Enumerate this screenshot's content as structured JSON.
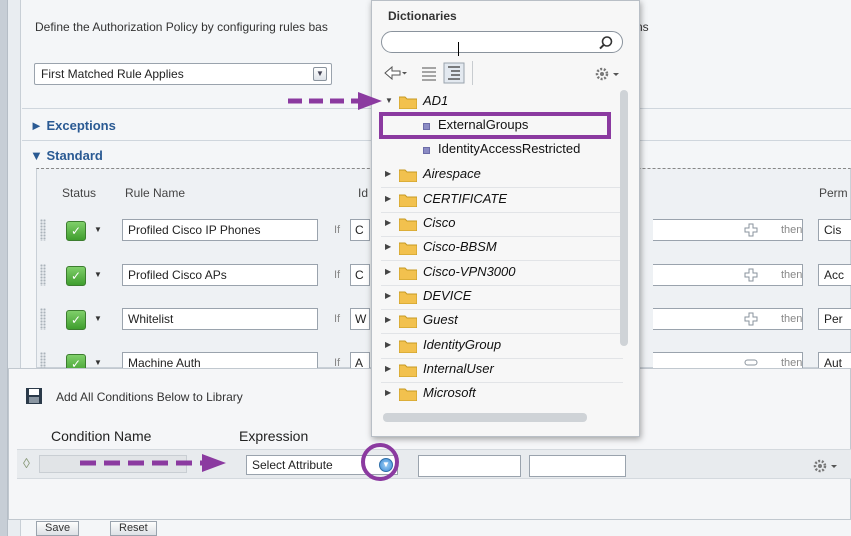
{
  "policy": {
    "description": "Define the Authorization Policy by configuring rules bas",
    "description_tail": "ns",
    "match_mode": "First Matched Rule Applies"
  },
  "sections": {
    "exceptions": "► Exceptions",
    "standard": "▼ Standard"
  },
  "table": {
    "col_status": "Status",
    "col_rule_name": "Rule Name",
    "col_identity": "Id",
    "col_permissions": "Perm"
  },
  "rules": [
    {
      "name": "Profiled Cisco IP Phones",
      "if": "If",
      "cond": "C",
      "then": "then",
      "perm": "Cis",
      "action_icon": "plus-icon"
    },
    {
      "name": "Profiled Cisco APs",
      "if": "If",
      "cond": "C",
      "then": "then",
      "perm": "Acc",
      "action_icon": "plus-icon"
    },
    {
      "name": "Whitelist",
      "if": "If",
      "cond": "W",
      "then": "then",
      "perm": "Per",
      "action_icon": "plus-icon"
    },
    {
      "name": "Machine Auth",
      "if": "If",
      "cond": "A",
      "then": "then",
      "perm": "Aut",
      "action_icon": "minus-icon"
    }
  ],
  "conditions_panel": {
    "add_all_label": "Add All Conditions Below to Library",
    "condition_name_header": "Condition Name",
    "expression_header": "Expression",
    "select_attribute": "Select Attribute"
  },
  "footer": {
    "save": "Save",
    "reset": "Reset"
  },
  "dictionaries": {
    "title": "Dictionaries",
    "search_placeholder": "",
    "tree": [
      {
        "label": "AD1",
        "expanded": true,
        "children": [
          "ExternalGroups",
          "IdentityAccessRestricted"
        ]
      },
      {
        "label": "Airespace"
      },
      {
        "label": "CERTIFICATE"
      },
      {
        "label": "Cisco"
      },
      {
        "label": "Cisco-BBSM"
      },
      {
        "label": "Cisco-VPN3000"
      },
      {
        "label": "DEVICE"
      },
      {
        "label": "Guest"
      },
      {
        "label": "IdentityGroup"
      },
      {
        "label": "InternalUser"
      },
      {
        "label": "Microsoft"
      }
    ]
  },
  "colors": {
    "annotation": "#8b3aa0",
    "section_header": "#2a5a93",
    "status_green": "#3f9e2e"
  }
}
